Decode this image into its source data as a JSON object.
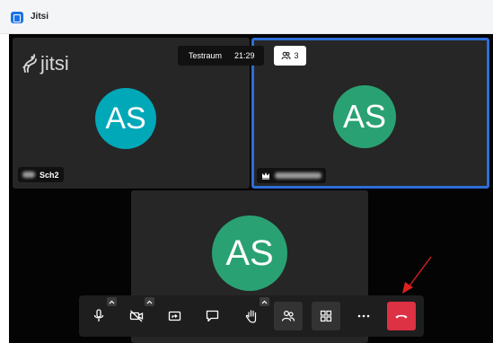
{
  "window": {
    "title": "Jitsi",
    "icon": "video-camera-icon",
    "accent": "#1a73e8"
  },
  "meeting": {
    "room_name": "Testraum",
    "duration": "21:29",
    "participant_count": "3"
  },
  "logo": {
    "text": "jitsi"
  },
  "participants": [
    {
      "initials": "AS",
      "name": "Sch2",
      "avatar_color": "#00a8b8",
      "active_speaker": false
    },
    {
      "initials": "AS",
      "name": "",
      "avatar_color": "#2aa172",
      "active_speaker": true,
      "moderator": true
    },
    {
      "initials": "AS",
      "name": "",
      "avatar_color": "#2aa172",
      "active_speaker": false
    }
  ],
  "toolbar": {
    "buttons": [
      {
        "id": "microphone",
        "icon": "microphone-icon",
        "has_menu": true
      },
      {
        "id": "camera",
        "icon": "camera-off-icon",
        "has_menu": true
      },
      {
        "id": "screen-share",
        "icon": "screen-share-icon",
        "has_menu": false
      },
      {
        "id": "chat",
        "icon": "chat-icon",
        "has_menu": false
      },
      {
        "id": "raise-hand",
        "icon": "raise-hand-icon",
        "has_menu": true
      },
      {
        "id": "participants",
        "icon": "participants-icon",
        "has_menu": false
      },
      {
        "id": "tile-view",
        "icon": "tile-view-icon",
        "has_menu": false
      },
      {
        "id": "more",
        "icon": "more-icon",
        "has_menu": false
      },
      {
        "id": "hangup",
        "icon": "hangup-icon",
        "has_menu": false
      }
    ],
    "hangup_color": "#dd3144"
  },
  "colors": {
    "active_border": "#2d6ed6",
    "annotation_arrow": "#e02020"
  }
}
